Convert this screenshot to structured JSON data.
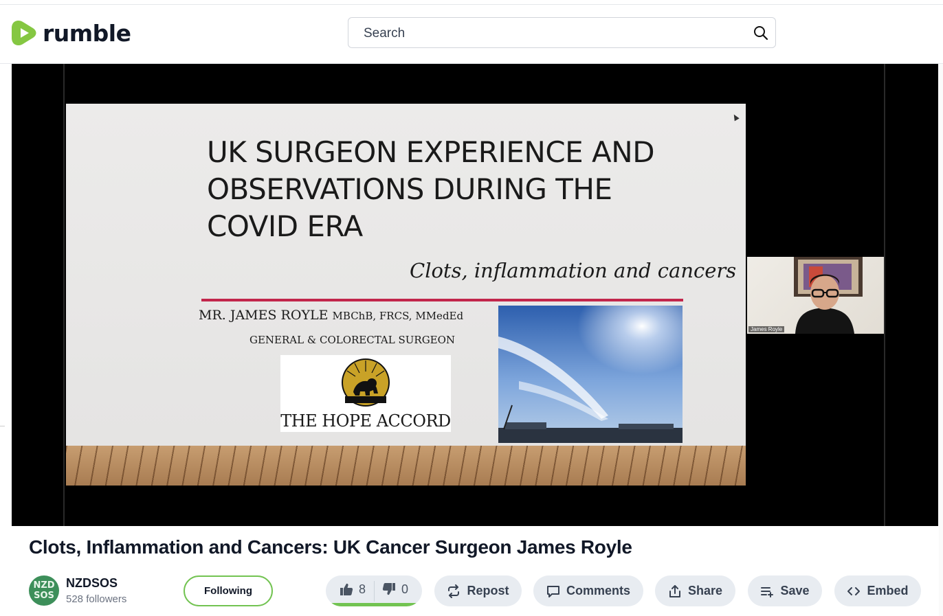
{
  "header": {
    "logo_text": "rumble",
    "search_placeholder": "Search",
    "brand_color": "#85c742"
  },
  "video": {
    "slide": {
      "title_lines": [
        "UK SURGEON EXPERIENCE AND",
        "OBSERVATIONS DURING THE",
        "COVID ERA"
      ],
      "subtitle": "Clots, inflammation and cancers",
      "author_name": "MR. JAMES ROYLE",
      "author_quals": "MBChB, FRCS, MMedEd",
      "author_role": "GENERAL & COLORECTAL SURGEON",
      "org_name": "THE HOPE ACCORD",
      "rule_color": "#c2264b"
    },
    "camera_label": "James Royle"
  },
  "title": "Clots, Inflammation and Cancers: UK Cancer Surgeon James Royle",
  "channel": {
    "avatar_lines": [
      "NZD",
      "SOS"
    ],
    "name": "NZDSOS",
    "followers": "528 followers",
    "follow_label": "Following",
    "follow_color": "#72c351"
  },
  "votes": {
    "likes": "8",
    "dislikes": "0",
    "like_ratio": 1.0
  },
  "actions": {
    "repost": "Repost",
    "comments": "Comments",
    "share": "Share",
    "save": "Save",
    "embed": "Embed"
  }
}
